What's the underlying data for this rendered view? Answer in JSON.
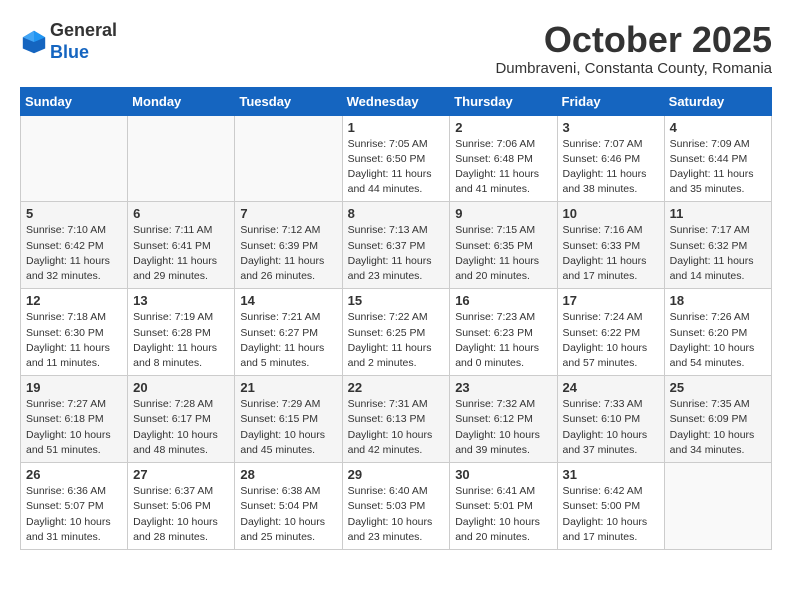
{
  "header": {
    "logo_line1": "General",
    "logo_line2": "Blue",
    "month": "October 2025",
    "location": "Dumbraveni, Constanta County, Romania"
  },
  "weekdays": [
    "Sunday",
    "Monday",
    "Tuesday",
    "Wednesday",
    "Thursday",
    "Friday",
    "Saturday"
  ],
  "weeks": [
    [
      {
        "day": "",
        "info": ""
      },
      {
        "day": "",
        "info": ""
      },
      {
        "day": "",
        "info": ""
      },
      {
        "day": "1",
        "info": "Sunrise: 7:05 AM\nSunset: 6:50 PM\nDaylight: 11 hours and 44 minutes."
      },
      {
        "day": "2",
        "info": "Sunrise: 7:06 AM\nSunset: 6:48 PM\nDaylight: 11 hours and 41 minutes."
      },
      {
        "day": "3",
        "info": "Sunrise: 7:07 AM\nSunset: 6:46 PM\nDaylight: 11 hours and 38 minutes."
      },
      {
        "day": "4",
        "info": "Sunrise: 7:09 AM\nSunset: 6:44 PM\nDaylight: 11 hours and 35 minutes."
      }
    ],
    [
      {
        "day": "5",
        "info": "Sunrise: 7:10 AM\nSunset: 6:42 PM\nDaylight: 11 hours and 32 minutes."
      },
      {
        "day": "6",
        "info": "Sunrise: 7:11 AM\nSunset: 6:41 PM\nDaylight: 11 hours and 29 minutes."
      },
      {
        "day": "7",
        "info": "Sunrise: 7:12 AM\nSunset: 6:39 PM\nDaylight: 11 hours and 26 minutes."
      },
      {
        "day": "8",
        "info": "Sunrise: 7:13 AM\nSunset: 6:37 PM\nDaylight: 11 hours and 23 minutes."
      },
      {
        "day": "9",
        "info": "Sunrise: 7:15 AM\nSunset: 6:35 PM\nDaylight: 11 hours and 20 minutes."
      },
      {
        "day": "10",
        "info": "Sunrise: 7:16 AM\nSunset: 6:33 PM\nDaylight: 11 hours and 17 minutes."
      },
      {
        "day": "11",
        "info": "Sunrise: 7:17 AM\nSunset: 6:32 PM\nDaylight: 11 hours and 14 minutes."
      }
    ],
    [
      {
        "day": "12",
        "info": "Sunrise: 7:18 AM\nSunset: 6:30 PM\nDaylight: 11 hours and 11 minutes."
      },
      {
        "day": "13",
        "info": "Sunrise: 7:19 AM\nSunset: 6:28 PM\nDaylight: 11 hours and 8 minutes."
      },
      {
        "day": "14",
        "info": "Sunrise: 7:21 AM\nSunset: 6:27 PM\nDaylight: 11 hours and 5 minutes."
      },
      {
        "day": "15",
        "info": "Sunrise: 7:22 AM\nSunset: 6:25 PM\nDaylight: 11 hours and 2 minutes."
      },
      {
        "day": "16",
        "info": "Sunrise: 7:23 AM\nSunset: 6:23 PM\nDaylight: 11 hours and 0 minutes."
      },
      {
        "day": "17",
        "info": "Sunrise: 7:24 AM\nSunset: 6:22 PM\nDaylight: 10 hours and 57 minutes."
      },
      {
        "day": "18",
        "info": "Sunrise: 7:26 AM\nSunset: 6:20 PM\nDaylight: 10 hours and 54 minutes."
      }
    ],
    [
      {
        "day": "19",
        "info": "Sunrise: 7:27 AM\nSunset: 6:18 PM\nDaylight: 10 hours and 51 minutes."
      },
      {
        "day": "20",
        "info": "Sunrise: 7:28 AM\nSunset: 6:17 PM\nDaylight: 10 hours and 48 minutes."
      },
      {
        "day": "21",
        "info": "Sunrise: 7:29 AM\nSunset: 6:15 PM\nDaylight: 10 hours and 45 minutes."
      },
      {
        "day": "22",
        "info": "Sunrise: 7:31 AM\nSunset: 6:13 PM\nDaylight: 10 hours and 42 minutes."
      },
      {
        "day": "23",
        "info": "Sunrise: 7:32 AM\nSunset: 6:12 PM\nDaylight: 10 hours and 39 minutes."
      },
      {
        "day": "24",
        "info": "Sunrise: 7:33 AM\nSunset: 6:10 PM\nDaylight: 10 hours and 37 minutes."
      },
      {
        "day": "25",
        "info": "Sunrise: 7:35 AM\nSunset: 6:09 PM\nDaylight: 10 hours and 34 minutes."
      }
    ],
    [
      {
        "day": "26",
        "info": "Sunrise: 6:36 AM\nSunset: 5:07 PM\nDaylight: 10 hours and 31 minutes."
      },
      {
        "day": "27",
        "info": "Sunrise: 6:37 AM\nSunset: 5:06 PM\nDaylight: 10 hours and 28 minutes."
      },
      {
        "day": "28",
        "info": "Sunrise: 6:38 AM\nSunset: 5:04 PM\nDaylight: 10 hours and 25 minutes."
      },
      {
        "day": "29",
        "info": "Sunrise: 6:40 AM\nSunset: 5:03 PM\nDaylight: 10 hours and 23 minutes."
      },
      {
        "day": "30",
        "info": "Sunrise: 6:41 AM\nSunset: 5:01 PM\nDaylight: 10 hours and 20 minutes."
      },
      {
        "day": "31",
        "info": "Sunrise: 6:42 AM\nSunset: 5:00 PM\nDaylight: 10 hours and 17 minutes."
      },
      {
        "day": "",
        "info": ""
      }
    ]
  ]
}
